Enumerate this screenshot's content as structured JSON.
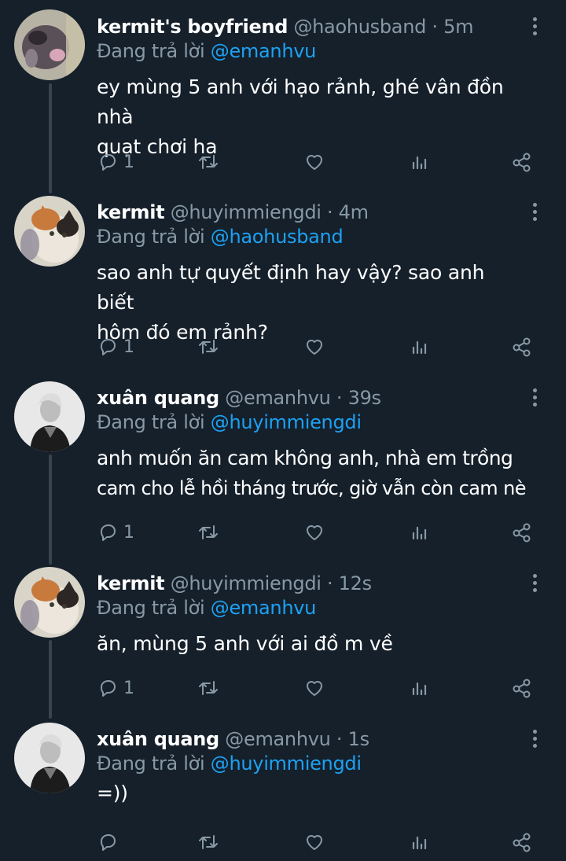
{
  "tweets": [
    {
      "display_name": "kermit's boyfriend",
      "handle": "@haohusband",
      "separator": "·",
      "time": "5m",
      "replying_prefix": "Đang trả lời",
      "replying_to": "@emanhvu",
      "lines": [
        "ey mùng 5 anh với hạo rảnh, ghé vân đồn nhà",
        "quạt chơi ha"
      ],
      "reply_count": "1",
      "avatar": "cat-blurry"
    },
    {
      "display_name": "kermit",
      "handle": "@huyimmiengdi",
      "separator": "·",
      "time": "4m",
      "replying_prefix": "Đang trả lời",
      "replying_to": "@haohusband",
      "lines": [
        "sao anh tự quyết định hay vậy? sao anh biết",
        "hôm đó em rảnh?"
      ],
      "reply_count": "1",
      "avatar": "calico-cat"
    },
    {
      "display_name": "xuân quang",
      "handle": "@emanhvu",
      "separator": "·",
      "time": "39s",
      "replying_prefix": "Đang trả lời",
      "replying_to": "@huyimmiengdi",
      "lines": [
        "anh muốn ăn cam không anh, nhà em trồng",
        "cam cho lễ hồi tháng trước, giờ vẫn còn cam nè"
      ],
      "reply_count": "1",
      "avatar": "man-bw"
    },
    {
      "display_name": "kermit",
      "handle": "@huyimmiengdi",
      "separator": "·",
      "time": "12s",
      "replying_prefix": "Đang trả lời",
      "replying_to": "@emanhvu",
      "lines": [
        "ăn, mùng 5 anh với ai đồ m về"
      ],
      "reply_count": "1",
      "avatar": "calico-cat"
    },
    {
      "display_name": "xuân quang",
      "handle": "@emanhvu",
      "separator": "·",
      "time": "1s",
      "replying_prefix": "Đang trả lời",
      "replying_to": "@huyimmiengdi",
      "lines": [
        "=))"
      ],
      "reply_count": "",
      "avatar": "man-bw"
    }
  ],
  "colors": {
    "background": "#15202b",
    "secondary_text": "#8899a6",
    "link": "#1da1f2",
    "thread_line": "#38444d"
  },
  "icons": [
    "reply-icon",
    "retweet-icon",
    "like-icon",
    "analytics-icon",
    "share-icon",
    "more-icon"
  ]
}
